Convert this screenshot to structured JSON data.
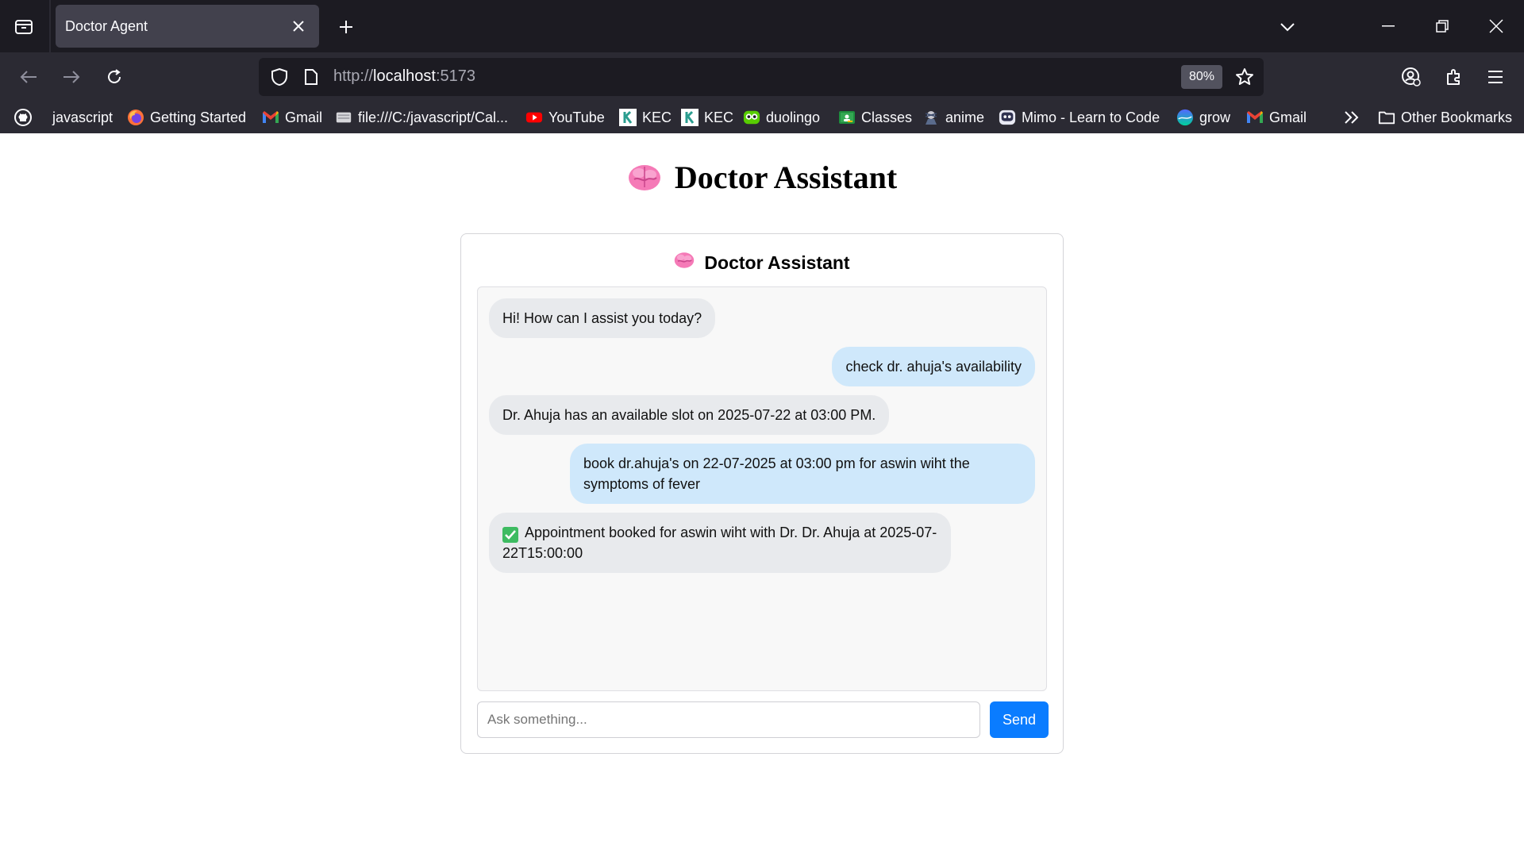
{
  "browser": {
    "tab_title": "Doctor Agent",
    "url_prefix": "http://",
    "url_host": "localhost",
    "url_port": ":5173",
    "zoom": "80%"
  },
  "bookmarks": {
    "items": [
      {
        "label": "javascript",
        "icon": "github-icon"
      },
      {
        "label": "Getting Started",
        "icon": "firefox-icon"
      },
      {
        "label": "Gmail",
        "icon": "gmail-icon"
      },
      {
        "label": "file:///C:/javascript/Cal...",
        "icon": "file-icon"
      },
      {
        "label": "YouTube",
        "icon": "youtube-icon"
      },
      {
        "label": "KEC",
        "icon": "kec-icon"
      },
      {
        "label": "KEC",
        "icon": "kec-icon"
      },
      {
        "label": "duolingo",
        "icon": "duolingo-icon"
      },
      {
        "label": "Classes",
        "icon": "classroom-icon"
      },
      {
        "label": "anime",
        "icon": "anime-icon"
      },
      {
        "label": "Mimo - Learn to Code",
        "icon": "mimo-icon"
      },
      {
        "label": "grow",
        "icon": "grow-icon"
      },
      {
        "label": "Gmail",
        "icon": "gmail-icon"
      }
    ],
    "other": "Other Bookmarks"
  },
  "page": {
    "heading": "Doctor Assistant",
    "card_title": "Doctor Assistant"
  },
  "chat": {
    "messages": [
      {
        "role": "bot",
        "text": "Hi! How can I assist you today?"
      },
      {
        "role": "user",
        "text": "check dr. ahuja's availability"
      },
      {
        "role": "bot",
        "text": "Dr. Ahuja has an available slot on 2025-07-22 at 03:00 PM."
      },
      {
        "role": "user",
        "text": "book dr.ahuja's on 22-07-2025 at 03:00 pm for aswin wiht the symptoms of fever"
      },
      {
        "role": "bot",
        "text": "Appointment booked for aswin wiht with Dr. Dr. Ahuja at 2025-07-22T15:00:00"
      }
    ],
    "input_placeholder": "Ask something...",
    "input_value": "",
    "send_label": "Send"
  },
  "colors": {
    "send_button": "#0a7cff",
    "user_bubble": "#cfe8fb",
    "bot_bubble": "#e8eaed"
  }
}
